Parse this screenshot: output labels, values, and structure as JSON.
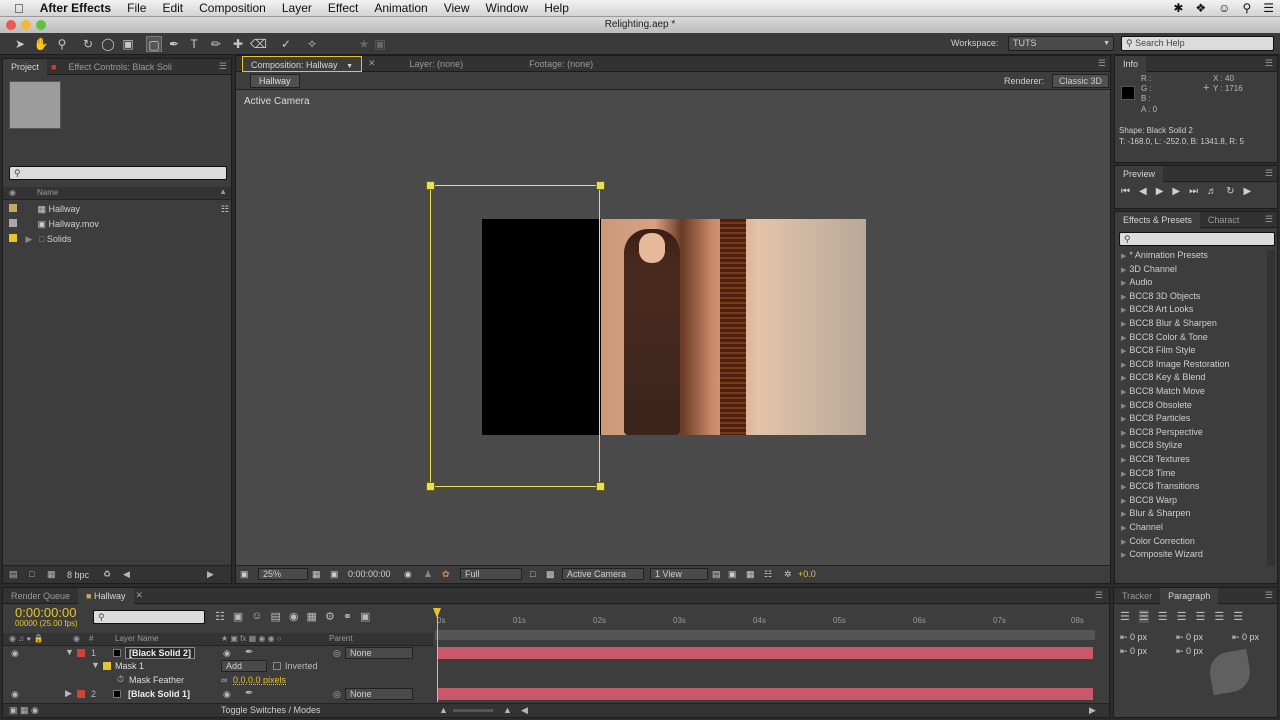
{
  "menubar": {
    "apple": "",
    "app": "After Effects",
    "items": [
      "File",
      "Edit",
      "Composition",
      "Layer",
      "Effect",
      "Animation",
      "View",
      "Window",
      "Help"
    ]
  },
  "window": {
    "title": "Relighting.aep *"
  },
  "toolbar": {
    "workspace_label": "Workspace:",
    "workspace_value": "TUTS",
    "search_help": "Search Help"
  },
  "project": {
    "tab": "Project",
    "tab2": "Effect Controls: Black Soli",
    "search_placeholder": "",
    "col_name": "Name",
    "items": [
      {
        "name": "Hallway",
        "type": "comp"
      },
      {
        "name": "Hallway.mov",
        "type": "footage"
      },
      {
        "name": "Solids",
        "type": "folder"
      }
    ],
    "bpc": "8 bpc"
  },
  "composition": {
    "tab": "Composition: Hallway",
    "layer_tab": "Layer: (none)",
    "footage_tab": "Footage: (none)",
    "breadcrumb": "Hallway",
    "renderer_label": "Renderer:",
    "renderer_value": "Classic 3D",
    "active_camera": "Active Camera",
    "zoom": "25%",
    "timecode": "0:00:00:00",
    "resolution": "Full",
    "view": "Active Camera",
    "views": "1 View",
    "exposure": "+0.0"
  },
  "info": {
    "tab": "Info",
    "r": "R :",
    "g": "G :",
    "b": "B :",
    "a": "A : 0",
    "x": "X : 40",
    "y": "Y : 1716",
    "shape": "Shape: Black Solid 2",
    "bounds": "T: -168.0, L: -252.0, B: 1341.8, R: 5"
  },
  "preview": {
    "tab": "Preview"
  },
  "effects": {
    "tab": "Effects & Presets",
    "tab2": "Charact",
    "items": [
      "* Animation Presets",
      "3D Channel",
      "Audio",
      "BCC8 3D Objects",
      "BCC8 Art Looks",
      "BCC8 Blur & Sharpen",
      "BCC8 Color & Tone",
      "BCC8 Film Style",
      "BCC8 Image Restoration",
      "BCC8 Key & Blend",
      "BCC8 Match Move",
      "BCC8 Obsolete",
      "BCC8 Particles",
      "BCC8 Perspective",
      "BCC8 Stylize",
      "BCC8 Textures",
      "BCC8 Time",
      "BCC8 Transitions",
      "BCC8 Warp",
      "Blur & Sharpen",
      "Channel",
      "Color Correction",
      "Composite Wizard"
    ]
  },
  "timeline": {
    "render_queue_tab": "Render Queue",
    "hallway_tab": "Hallway",
    "timecode": "0:00:00:00",
    "frame_info": "00000 (25.00 fps)",
    "col_layer_name": "Layer Name",
    "col_parent": "Parent",
    "ruler": [
      "0s",
      "01s",
      "02s",
      "03s",
      "04s",
      "05s",
      "06s",
      "07s",
      "08s"
    ],
    "layers": [
      {
        "num": "1",
        "name": "[Black Solid 2]",
        "parent": "None"
      },
      {
        "num": "2",
        "name": "[Black Solid 1]",
        "parent": "None"
      }
    ],
    "mask_name": "Mask 1",
    "mask_mode": "Add",
    "mask_inverted": "Inverted",
    "mask_feather_label": "Mask Feather",
    "mask_feather_value": "0.0,0.0 pixels",
    "toggle": "Toggle Switches / Modes"
  },
  "tracker": {
    "tab": "Tracker"
  },
  "paragraph": {
    "tab": "Paragraph",
    "indent1": "0 px",
    "indent2": "0 px",
    "indent3": "0 px",
    "space1": "0 px",
    "space2": "0 px"
  },
  "colors": {
    "accent": "#e5c430",
    "layer_bar": "#c8586a"
  }
}
